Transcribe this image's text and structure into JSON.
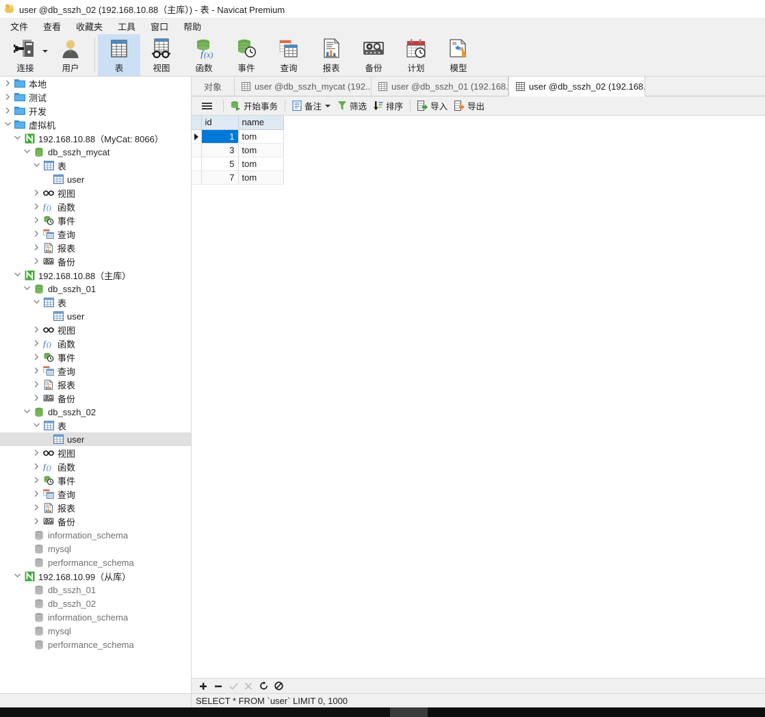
{
  "window": {
    "title": "user @db_sszh_02 (192.168.10.88（主库）) - 表 - Navicat Premium",
    "logo_icon": "navicat-logo-icon"
  },
  "menubar": {
    "items": [
      {
        "label": "文件",
        "name": "menu-file"
      },
      {
        "label": "查看",
        "name": "menu-view"
      },
      {
        "label": "收藏夹",
        "name": "menu-favorites"
      },
      {
        "label": "工具",
        "name": "menu-tools"
      },
      {
        "label": "窗口",
        "name": "menu-window"
      },
      {
        "label": "帮助",
        "name": "menu-help"
      }
    ]
  },
  "toolbar": {
    "buttons": [
      {
        "label": "连接",
        "icon": "connection-icon",
        "name": "toolbar-connection",
        "active": false,
        "dropdown": true
      },
      {
        "label": "用户",
        "icon": "user-icon",
        "name": "toolbar-user",
        "active": false,
        "dropdown": false
      },
      {
        "label": "表",
        "icon": "table-icon",
        "name": "toolbar-table",
        "active": true,
        "dropdown": false
      },
      {
        "label": "视图",
        "icon": "view-icon",
        "name": "toolbar-view",
        "active": false,
        "dropdown": false
      },
      {
        "label": "函数",
        "icon": "function-icon",
        "name": "toolbar-function",
        "active": false,
        "dropdown": false
      },
      {
        "label": "事件",
        "icon": "event-icon",
        "name": "toolbar-event",
        "active": false,
        "dropdown": false
      },
      {
        "label": "查询",
        "icon": "query-icon",
        "name": "toolbar-query",
        "active": false,
        "dropdown": false
      },
      {
        "label": "报表",
        "icon": "report-icon",
        "name": "toolbar-report",
        "active": false,
        "dropdown": false
      },
      {
        "label": "备份",
        "icon": "backup-icon",
        "name": "toolbar-backup",
        "active": false,
        "dropdown": false
      },
      {
        "label": "计划",
        "icon": "schedule-icon",
        "name": "toolbar-schedule",
        "active": false,
        "dropdown": false
      },
      {
        "label": "模型",
        "icon": "model-icon",
        "name": "toolbar-model",
        "active": false,
        "dropdown": false
      }
    ],
    "accent_active_bg": "#cce0f5"
  },
  "sidebar": {
    "tree": [
      {
        "label": "本地",
        "icon": "folder-icon",
        "indent": 0,
        "state": "collapsed",
        "name": "tree-node-local"
      },
      {
        "label": "测试",
        "icon": "folder-icon",
        "indent": 0,
        "state": "collapsed",
        "name": "tree-node-test"
      },
      {
        "label": "开发",
        "icon": "folder-icon",
        "indent": 0,
        "state": "collapsed",
        "name": "tree-node-dev"
      },
      {
        "label": "虚拟机",
        "icon": "folder-icon",
        "indent": 0,
        "state": "expanded",
        "name": "tree-node-vm"
      },
      {
        "label": "192.168.10.88（MyCat: 8066）",
        "icon": "mysql-connection-icon",
        "indent": 1,
        "state": "expanded",
        "name": "tree-node-conn-mycat"
      },
      {
        "label": "db_sszh_mycat",
        "icon": "database-icon",
        "indent": 2,
        "state": "expanded",
        "name": "tree-node-db-sszh-mycat"
      },
      {
        "label": "表",
        "icon": "table-group-icon",
        "indent": 3,
        "state": "expanded",
        "name": "tree-node-tables-mycat"
      },
      {
        "label": "user",
        "icon": "table-icon",
        "indent": 4,
        "state": "leaf",
        "name": "tree-node-table-user-mycat"
      },
      {
        "label": "视图",
        "icon": "view-group-icon",
        "indent": 3,
        "state": "collapsed",
        "name": "tree-node-views-mycat"
      },
      {
        "label": "函数",
        "icon": "function-group-icon",
        "indent": 3,
        "state": "collapsed",
        "name": "tree-node-functions-mycat"
      },
      {
        "label": "事件",
        "icon": "event-group-icon",
        "indent": 3,
        "state": "collapsed",
        "name": "tree-node-events-mycat"
      },
      {
        "label": "查询",
        "icon": "query-group-icon",
        "indent": 3,
        "state": "collapsed",
        "name": "tree-node-queries-mycat"
      },
      {
        "label": "报表",
        "icon": "report-group-icon",
        "indent": 3,
        "state": "collapsed",
        "name": "tree-node-reports-mycat"
      },
      {
        "label": "备份",
        "icon": "backup-group-icon",
        "indent": 3,
        "state": "collapsed",
        "name": "tree-node-backups-mycat"
      },
      {
        "label": "192.168.10.88（主库）",
        "icon": "mysql-connection-icon",
        "indent": 1,
        "state": "expanded",
        "name": "tree-node-conn-master"
      },
      {
        "label": "db_sszh_01",
        "icon": "database-icon",
        "indent": 2,
        "state": "expanded",
        "name": "tree-node-db-sszh-01"
      },
      {
        "label": "表",
        "icon": "table-group-icon",
        "indent": 3,
        "state": "expanded",
        "name": "tree-node-tables-01"
      },
      {
        "label": "user",
        "icon": "table-icon",
        "indent": 4,
        "state": "leaf",
        "name": "tree-node-table-user-01"
      },
      {
        "label": "视图",
        "icon": "view-group-icon",
        "indent": 3,
        "state": "collapsed",
        "name": "tree-node-views-01"
      },
      {
        "label": "函数",
        "icon": "function-group-icon",
        "indent": 3,
        "state": "collapsed",
        "name": "tree-node-functions-01"
      },
      {
        "label": "事件",
        "icon": "event-group-icon",
        "indent": 3,
        "state": "collapsed",
        "name": "tree-node-events-01"
      },
      {
        "label": "查询",
        "icon": "query-group-icon",
        "indent": 3,
        "state": "collapsed",
        "name": "tree-node-queries-01"
      },
      {
        "label": "报表",
        "icon": "report-group-icon",
        "indent": 3,
        "state": "collapsed",
        "name": "tree-node-reports-01"
      },
      {
        "label": "备份",
        "icon": "backup-group-icon",
        "indent": 3,
        "state": "collapsed",
        "name": "tree-node-backups-01"
      },
      {
        "label": "db_sszh_02",
        "icon": "database-icon",
        "indent": 2,
        "state": "expanded",
        "name": "tree-node-db-sszh-02"
      },
      {
        "label": "表",
        "icon": "table-group-icon",
        "indent": 3,
        "state": "expanded",
        "name": "tree-node-tables-02"
      },
      {
        "label": "user",
        "icon": "table-icon",
        "indent": 4,
        "state": "leaf",
        "selected": true,
        "name": "tree-node-table-user-02"
      },
      {
        "label": "视图",
        "icon": "view-group-icon",
        "indent": 3,
        "state": "collapsed",
        "name": "tree-node-views-02"
      },
      {
        "label": "函数",
        "icon": "function-group-icon",
        "indent": 3,
        "state": "collapsed",
        "name": "tree-node-functions-02"
      },
      {
        "label": "事件",
        "icon": "event-group-icon",
        "indent": 3,
        "state": "collapsed",
        "name": "tree-node-events-02"
      },
      {
        "label": "查询",
        "icon": "query-group-icon",
        "indent": 3,
        "state": "collapsed",
        "name": "tree-node-queries-02"
      },
      {
        "label": "报表",
        "icon": "report-group-icon",
        "indent": 3,
        "state": "collapsed",
        "name": "tree-node-reports-02"
      },
      {
        "label": "备份",
        "icon": "backup-group-icon",
        "indent": 3,
        "state": "collapsed",
        "name": "tree-node-backups-02"
      },
      {
        "label": "information_schema",
        "icon": "database-closed-icon",
        "indent": 2,
        "state": "leaf",
        "dim": true,
        "name": "tree-node-db-information-schema-master"
      },
      {
        "label": "mysql",
        "icon": "database-closed-icon",
        "indent": 2,
        "state": "leaf",
        "dim": true,
        "name": "tree-node-db-mysql-master"
      },
      {
        "label": "performance_schema",
        "icon": "database-closed-icon",
        "indent": 2,
        "state": "leaf",
        "dim": true,
        "name": "tree-node-db-performance-schema-master"
      },
      {
        "label": "192.168.10.99（从库）",
        "icon": "mysql-connection-icon",
        "indent": 1,
        "state": "expanded",
        "name": "tree-node-conn-slave"
      },
      {
        "label": "db_sszh_01",
        "icon": "database-closed-icon",
        "indent": 2,
        "state": "leaf",
        "dim": true,
        "name": "tree-node-slave-db-sszh-01"
      },
      {
        "label": "db_sszh_02",
        "icon": "database-closed-icon",
        "indent": 2,
        "state": "leaf",
        "dim": true,
        "name": "tree-node-slave-db-sszh-02"
      },
      {
        "label": "information_schema",
        "icon": "database-closed-icon",
        "indent": 2,
        "state": "leaf",
        "dim": true,
        "name": "tree-node-slave-db-information-schema"
      },
      {
        "label": "mysql",
        "icon": "database-closed-icon",
        "indent": 2,
        "state": "leaf",
        "dim": true,
        "name": "tree-node-slave-db-mysql"
      },
      {
        "label": "performance_schema",
        "icon": "database-closed-icon",
        "indent": 2,
        "state": "leaf",
        "dim": true,
        "name": "tree-node-slave-db-performance-schema"
      }
    ]
  },
  "main": {
    "tabs": [
      {
        "label": "对象",
        "icon": null,
        "active": false,
        "name": "tab-objects"
      },
      {
        "label": "user @db_sszh_mycat (192....",
        "icon": "table-icon",
        "active": false,
        "name": "tab-user-mycat"
      },
      {
        "label": "user @db_sszh_01 (192.168....",
        "icon": "table-icon",
        "active": false,
        "name": "tab-user-01"
      },
      {
        "label": "user @db_sszh_02 (192.168....",
        "icon": "table-icon",
        "active": true,
        "name": "tab-user-02"
      }
    ],
    "grid_toolbar": [
      {
        "label": "",
        "icon": "hamburger-icon",
        "name": "grid-menu-button"
      },
      {
        "label": "开始事务",
        "icon": "begin-transaction-icon",
        "name": "begin-transaction-button"
      },
      {
        "label": "备注",
        "icon": "note-icon",
        "caret": true,
        "name": "note-button"
      },
      {
        "label": "筛选",
        "icon": "filter-icon",
        "name": "filter-button"
      },
      {
        "label": "排序",
        "icon": "sort-icon",
        "name": "sort-button"
      },
      {
        "label": "导入",
        "icon": "import-icon",
        "name": "import-button"
      },
      {
        "label": "导出",
        "icon": "export-icon",
        "name": "export-button"
      }
    ],
    "nav_buttons": [
      {
        "icon": "plus-icon",
        "label": "+",
        "name": "add-record-button",
        "disabled": false
      },
      {
        "icon": "minus-icon",
        "label": "−",
        "name": "delete-record-button",
        "disabled": false
      },
      {
        "icon": "check-icon",
        "label": "✓",
        "name": "apply-change-button",
        "disabled": true
      },
      {
        "icon": "cross-icon",
        "label": "✕",
        "name": "discard-change-button",
        "disabled": true
      },
      {
        "icon": "refresh-icon",
        "label": "⟳",
        "name": "refresh-button",
        "disabled": false
      },
      {
        "icon": "stop-icon",
        "label": "⊘",
        "name": "stop-button",
        "disabled": false
      }
    ],
    "sql_status": "SELECT * FROM `user` LIMIT 0, 1000"
  },
  "grid_data": {
    "type": "table",
    "columns": [
      "id",
      "name"
    ],
    "rows": [
      {
        "id": "1",
        "name": "tom",
        "current": true
      },
      {
        "id": "3",
        "name": "tom",
        "current": false
      },
      {
        "id": "5",
        "name": "tom",
        "current": false
      },
      {
        "id": "7",
        "name": "tom",
        "current": false
      }
    ],
    "selected_cell": {
      "row": 0,
      "column": "id"
    },
    "selection_color": "#0078d7"
  }
}
